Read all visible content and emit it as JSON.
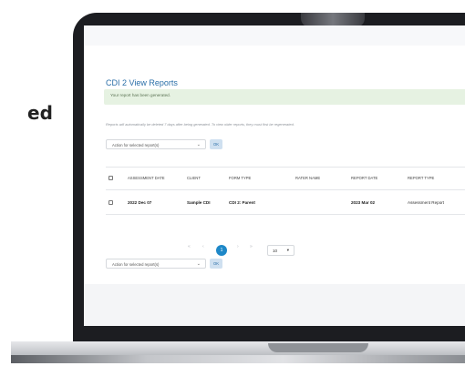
{
  "side_text": "ed",
  "page": {
    "title": "CDI 2 View Reports",
    "alert": "Your report has been generated.",
    "note": "Reports will automatically be deleted 7 days after being generated. To view older reports, they must first be regenerated.",
    "bulk_action_placeholder": "Action for selected report(s)",
    "ok_label": "OK",
    "chevron": "⌄"
  },
  "table": {
    "columns": [
      "ASSESSMENT DATE",
      "CLIENT",
      "FORM TYPE",
      "RATER NAME",
      "REPORT DATE",
      "REPORT TYPE"
    ],
    "rows": [
      {
        "assessment_date": "2022 Dec 07",
        "client": "Sample CDI",
        "form_type": "CDI 2: Parent",
        "rater_name": "",
        "report_date": "2023 Mar 02",
        "report_type": "Assessment Report"
      }
    ]
  },
  "pagination": {
    "first": "«",
    "prev": "‹",
    "current": "1",
    "next": "›",
    "last": "»",
    "page_size": "10",
    "page_size_arrow": "▾"
  },
  "colors": {
    "accent": "#1e88c8",
    "title": "#2b6fa8",
    "alert_bg": "#e6f2e2",
    "ok_bg": "#cfe0f0"
  }
}
